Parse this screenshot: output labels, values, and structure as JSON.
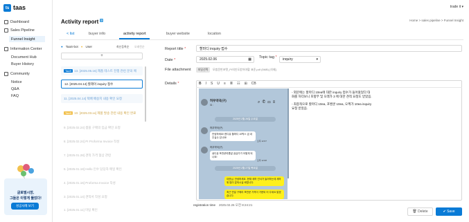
{
  "app": {
    "logo_letter": "ts",
    "name": "taas",
    "user": "trade it"
  },
  "sidebar": {
    "items": [
      {
        "label": "Dashboard"
      },
      {
        "label": "Sales Pipeline"
      },
      {
        "label": "Funnel Insight"
      },
      {
        "label": "Information Center"
      },
      {
        "label": "Document Hub"
      },
      {
        "label": "Buyer History"
      },
      {
        "label": "Community"
      },
      {
        "label": "Notice"
      },
      {
        "label": "Q&A"
      },
      {
        "label": "FAQ"
      }
    ],
    "promo": {
      "line1": "글로벌시장,",
      "line2": "그들은 이렇게 뚫었다!",
      "button": "성공사례 보기"
    }
  },
  "page": {
    "title": "Activity report",
    "breadcrumb": "Home > sales pipeline > Funnel Insight"
  },
  "tabs": [
    "< list",
    "buyer info",
    "activity report",
    "buyer website",
    "location"
  ],
  "filters": {
    "legend1": "TaaS-bot",
    "legend2": "User",
    "sort1": "최신등록순",
    "sort2": "오래된순",
    "add_symbol": "+"
  },
  "list": [
    {
      "text": "13. [2025.05.16] 제품 테스트 진행 관련 문의 메",
      "tag": "TaaS"
    },
    {
      "text": "12. [2025.04.14] 할레이 inquiry 접수",
      "tag": ""
    },
    {
      "text": "11. [2025.04.14] 택배 배송지 내용 확인 요청",
      "tag": ""
    },
    {
      "text": "10. [2025.03.xx] 제품 발송 관련 내용 확인 완료",
      "tag": "TaaS"
    },
    {
      "text": "9. [2025.02.24] 샘플 구매의 입금 확인 요청",
      "tag": ""
    },
    {
      "text": "8. [2025.02.24] PI Proforma Invoice 작성",
      "tag": ""
    },
    {
      "text": "7. [2025.01.28] 견적 가격 협상 관련",
      "tag": ""
    },
    {
      "text": "6. [2025.01.28] 관 샘플 견적 협상서 작성",
      "tag": ""
    },
    {
      "text": "5. [2025.01.18] Hello 인수 담당자 메일 확인",
      "tag": ""
    },
    {
      "text": "4. [2025.01.16] Proforma Invoice 작성",
      "tag": ""
    },
    {
      "text": "3. [2025.01.14] 견적서 작성 요청",
      "tag": ""
    },
    {
      "text": "2. [2025.01.xx] 샘플 검토 요청 내용",
      "tag": ""
    },
    {
      "text": "1. [2025.01.11] 미팅 확인",
      "tag": ""
    }
  ],
  "form": {
    "report_title_label": "Report title",
    "report_title_value": "할마디 inquiry 접수",
    "date_label": "Date",
    "date_value": "2025.02.06",
    "topic_label": "Topic tag",
    "topic_value": "inquiry",
    "attach_label": "File attachment",
    "attach_button": "파일선택",
    "attach_file": "모범운반포맷_PI의인도받아야할 표준.pdf (5MB) [삭제]",
    "details_label": "Details",
    "toolbar": [
      "B",
      "I",
      "S",
      "U",
      "≡",
      "≣",
      "☷",
      "⊞",
      "CB"
    ],
    "notes_line1": "- 외문에는 할마디 10ea에 대한 inquiry 접수가 들어왔었다 대",
    "notes_line2": "화를 하더보니 포항부 및 오래가 3 에 대한 견적 요청도 받았음.",
    "notes_line3": "- 최종적으로 할마디 10ea, 포밴쿤 10ea, 오케가 10ea inquiry",
    "notes_line4": "요청 받았음.",
    "registration_label": "registration time",
    "registration_value": "2025.02.26 오전 8:24:21",
    "delete_label": "Delete",
    "save_label": "Save"
  },
  "chat": {
    "header_title": "허우약국(구)",
    "header_sub": "요 :",
    "date1": "2025년 2월 26일 수요일",
    "sender": "허우약국(구)",
    "msg1": "안녕하세요! 한디유 할마디 10박스 금 내주실수 있나요!",
    "time1": "오후 12:07",
    "msg2": "큐디유 포반쿤여름갈 공급가가 어떻게 되나요!",
    "time2": "오후 12:08",
    "date2": "2025년 2월 27일 목요일",
    "msg3": "대표님, 안녕하세요. 현재 세하 건서가 놀어하는데 세하 위 많이 분되시실 바랍니다.",
    "msg4": "최근 연일 구매라 포반쿤 가격이 가현되 어 주세요 알겠습니다."
  }
}
